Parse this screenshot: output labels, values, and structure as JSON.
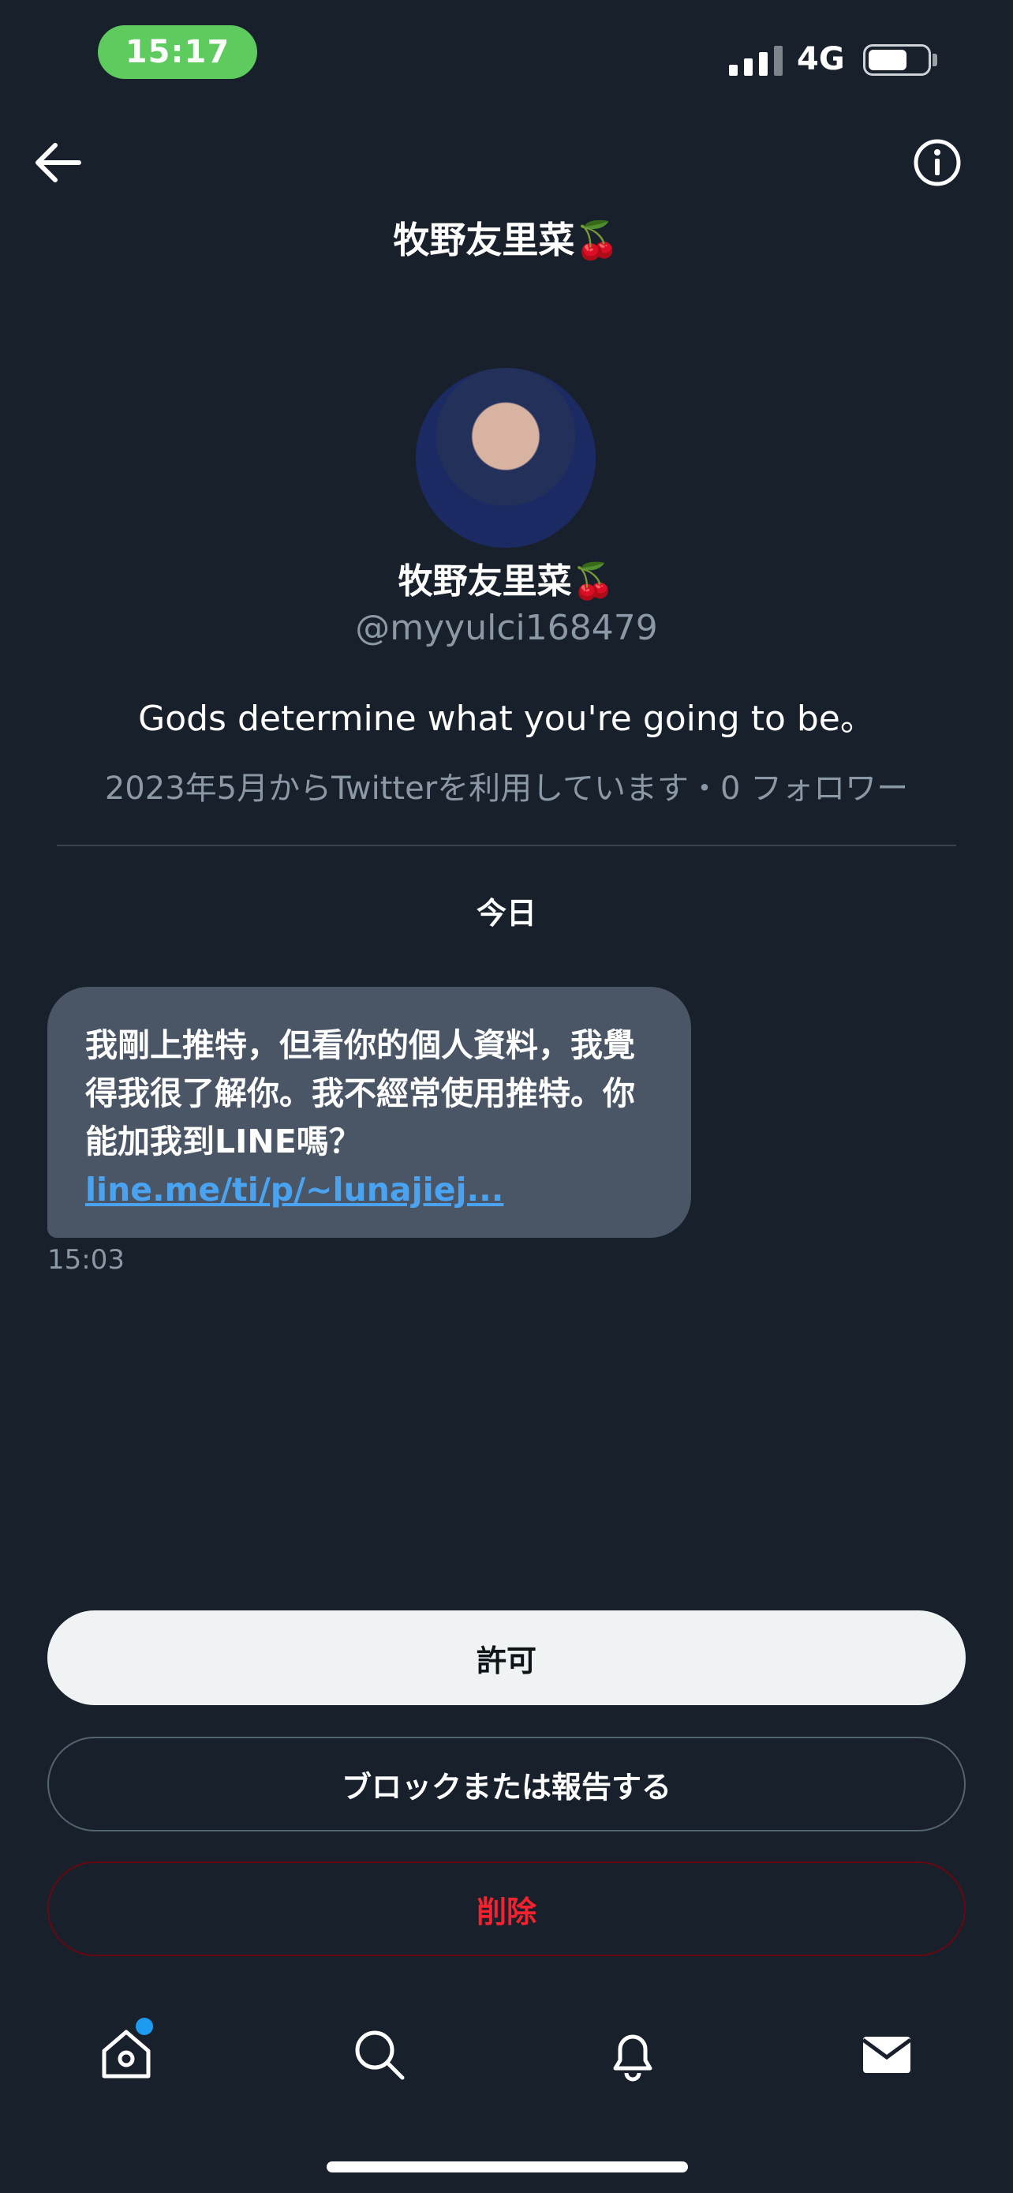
{
  "status_bar": {
    "time": "15:17",
    "network": "4G",
    "battery_level_fraction": 0.65,
    "signal_bars": 4
  },
  "header": {
    "title": "牧野友里菜🍒",
    "back_icon": "arrow-left-icon",
    "info_icon": "info-circle-icon"
  },
  "profile": {
    "name": "牧野友里菜🍒",
    "handle": "@myyulci168479",
    "bio": "Gods determine what you're going to be。",
    "meta": "2023年5月からTwitterを利用しています・0 フォロワー"
  },
  "conversation": {
    "day_label": "今日",
    "messages": [
      {
        "text": "我剛上推特，但看你的個人資料，我覺得我很了解你。我不經常使用推特。你能加我到LINE嗎？ ",
        "link": "line.me/ti/p/~lunajiej...",
        "time": "15:03"
      }
    ]
  },
  "actions": {
    "allow": "許可",
    "block_or_report": "ブロックまたは報告する",
    "delete": "削除"
  },
  "tab_bar": {
    "tabs": [
      "home-icon",
      "search-icon",
      "bell-icon",
      "mail-icon"
    ],
    "active": "mail-icon",
    "home_has_badge": true
  },
  "colors": {
    "background": "#18202b",
    "bubble": "#4a5566",
    "link": "#4aa3f0",
    "danger": "#f4212e",
    "status_pill": "#5dcb5e",
    "badge": "#1d9bf0"
  }
}
